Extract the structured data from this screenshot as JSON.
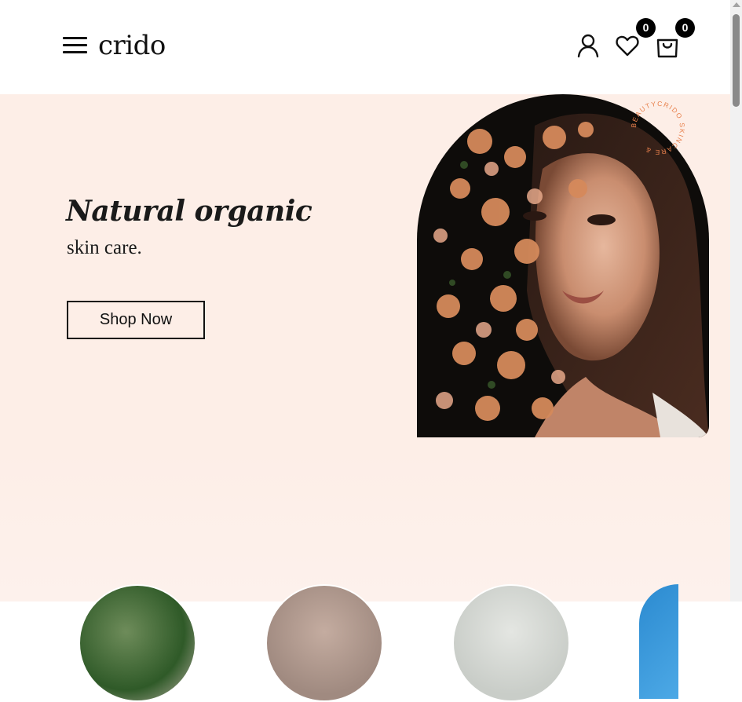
{
  "header": {
    "logo": "crido",
    "icons": {
      "menu": "hamburger-menu-icon",
      "account": "user-icon",
      "wishlist": "heart-icon",
      "cart": "shopping-bag-icon"
    },
    "wishlist_count": "0",
    "cart_count": "0"
  },
  "hero": {
    "title": "Natural organic",
    "subtitle": "skin care.",
    "cta_label": "Shop Now",
    "stamp_text": "BEAUTYCRIDO SKINCARE & "
  },
  "colors": {
    "hero_bg": "#fdeee7",
    "stamp": "#e8804c",
    "text": "#1a1a1a"
  }
}
